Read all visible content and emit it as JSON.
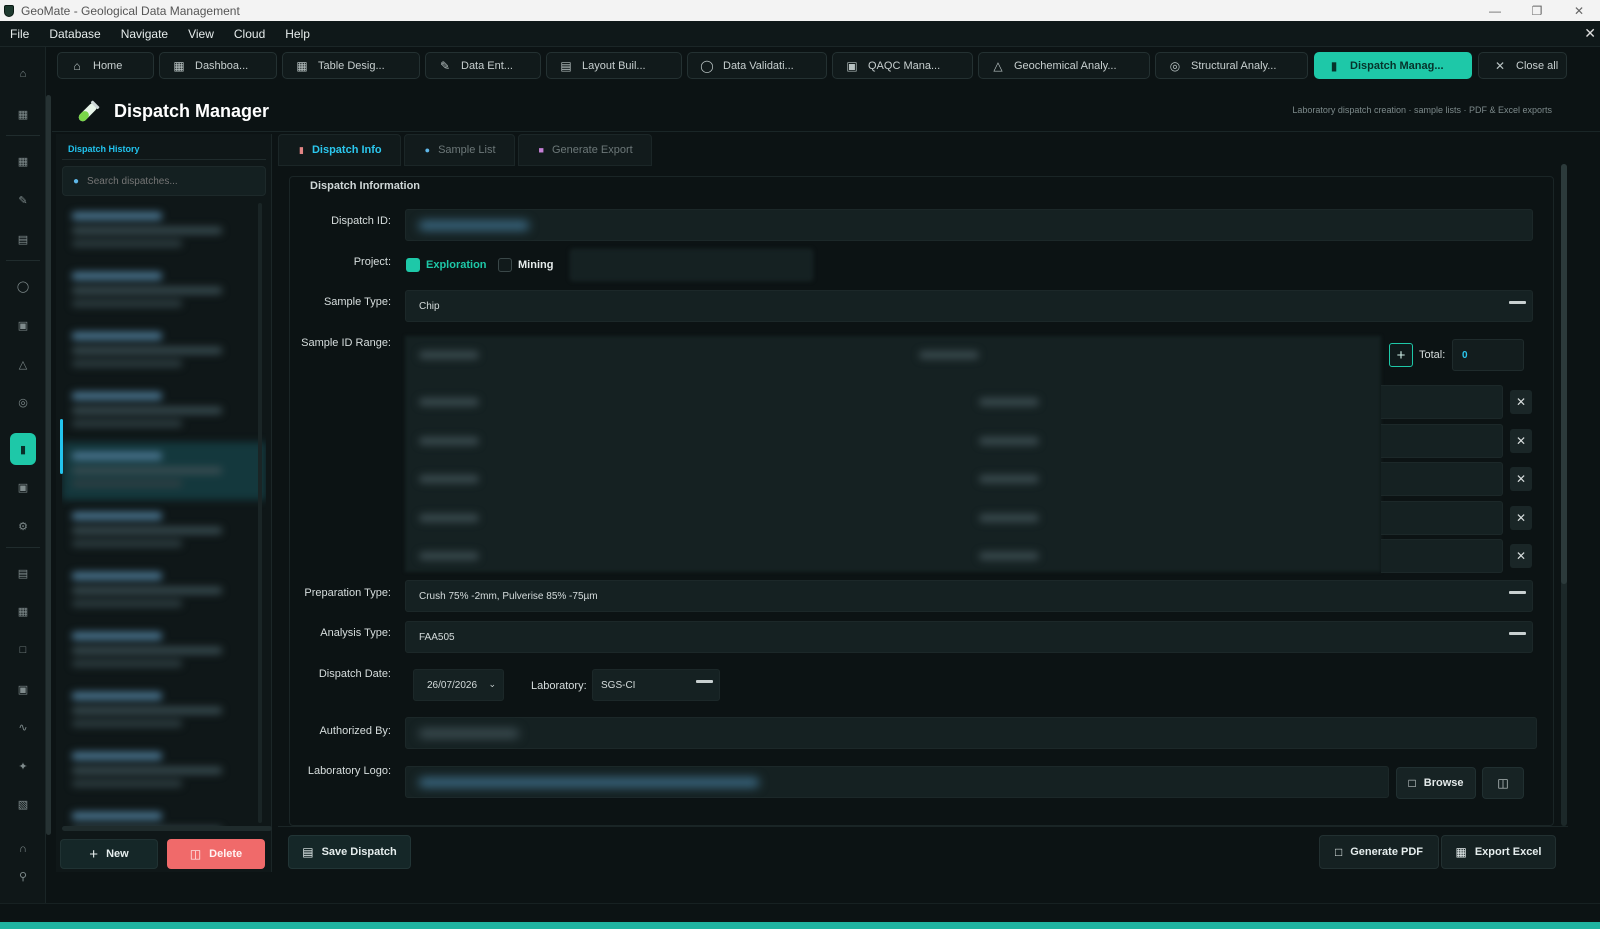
{
  "window": {
    "title": "GeoMate - Geological Data Management"
  },
  "menubar": {
    "items": [
      "File",
      "Database",
      "Navigate",
      "View",
      "Cloud",
      "Help"
    ]
  },
  "tabs": [
    {
      "label": "Home",
      "icon": "home-icon"
    },
    {
      "label": "Dashboa...",
      "icon": "dashboard-icon"
    },
    {
      "label": "Table Desig...",
      "icon": "table-icon"
    },
    {
      "label": "Data Ent...",
      "icon": "edit-icon"
    },
    {
      "label": "Layout Buil...",
      "icon": "layout-icon"
    },
    {
      "label": "Data Validati...",
      "icon": "shield-check-icon"
    },
    {
      "label": "QAQC Mana...",
      "icon": "clipboard-check-icon"
    },
    {
      "label": "Geochemical Analy...",
      "icon": "flask-icon"
    },
    {
      "label": "Structural Analy...",
      "icon": "compass-icon"
    },
    {
      "label": "Dispatch Manag...",
      "icon": "truck-icon",
      "active": true
    }
  ],
  "close_all_label": "Close all",
  "page": {
    "title": "Dispatch Manager",
    "subtitle": "Laboratory dispatch creation · sample lists · PDF & Excel exports"
  },
  "history": {
    "title": "Dispatch History",
    "search_placeholder": "Search dispatches...",
    "new_label": "New",
    "delete_label": "Delete"
  },
  "form_tabs": [
    "Dispatch Info",
    "Sample List",
    "Generate Export"
  ],
  "form": {
    "section_title": "Dispatch Information",
    "labels": {
      "dispatch_id": "Dispatch ID:",
      "project": "Project:",
      "sample_type": "Sample Type:",
      "sample_id_range": "Sample ID Range:",
      "preparation_type": "Preparation Type:",
      "analysis_type": "Analysis Type:",
      "dispatch_date": "Dispatch Date:",
      "laboratory": "Laboratory:",
      "authorized_by": "Authorized By:",
      "laboratory_logo": "Laboratory Logo:",
      "total": "Total:"
    },
    "project_options": [
      {
        "label": "Exploration",
        "checked": true
      },
      {
        "label": "Mining",
        "checked": false
      }
    ],
    "sample_type": "Chip",
    "total": "0",
    "preparation_type": "Crush 75% -2mm, Pulverise 85% -75µm",
    "analysis_type": "FAA505",
    "dispatch_date": "26/07/2026",
    "laboratory": "SGS-CI",
    "browse_label": "Browse"
  },
  "actions": {
    "save": "Save Dispatch",
    "generate_pdf": "Generate PDF",
    "export_excel": "Export Excel"
  },
  "colors": {
    "accent": "#1ec8a8",
    "link": "#21c3ee",
    "danger": "#f06a6a",
    "background": "#0c1314"
  }
}
